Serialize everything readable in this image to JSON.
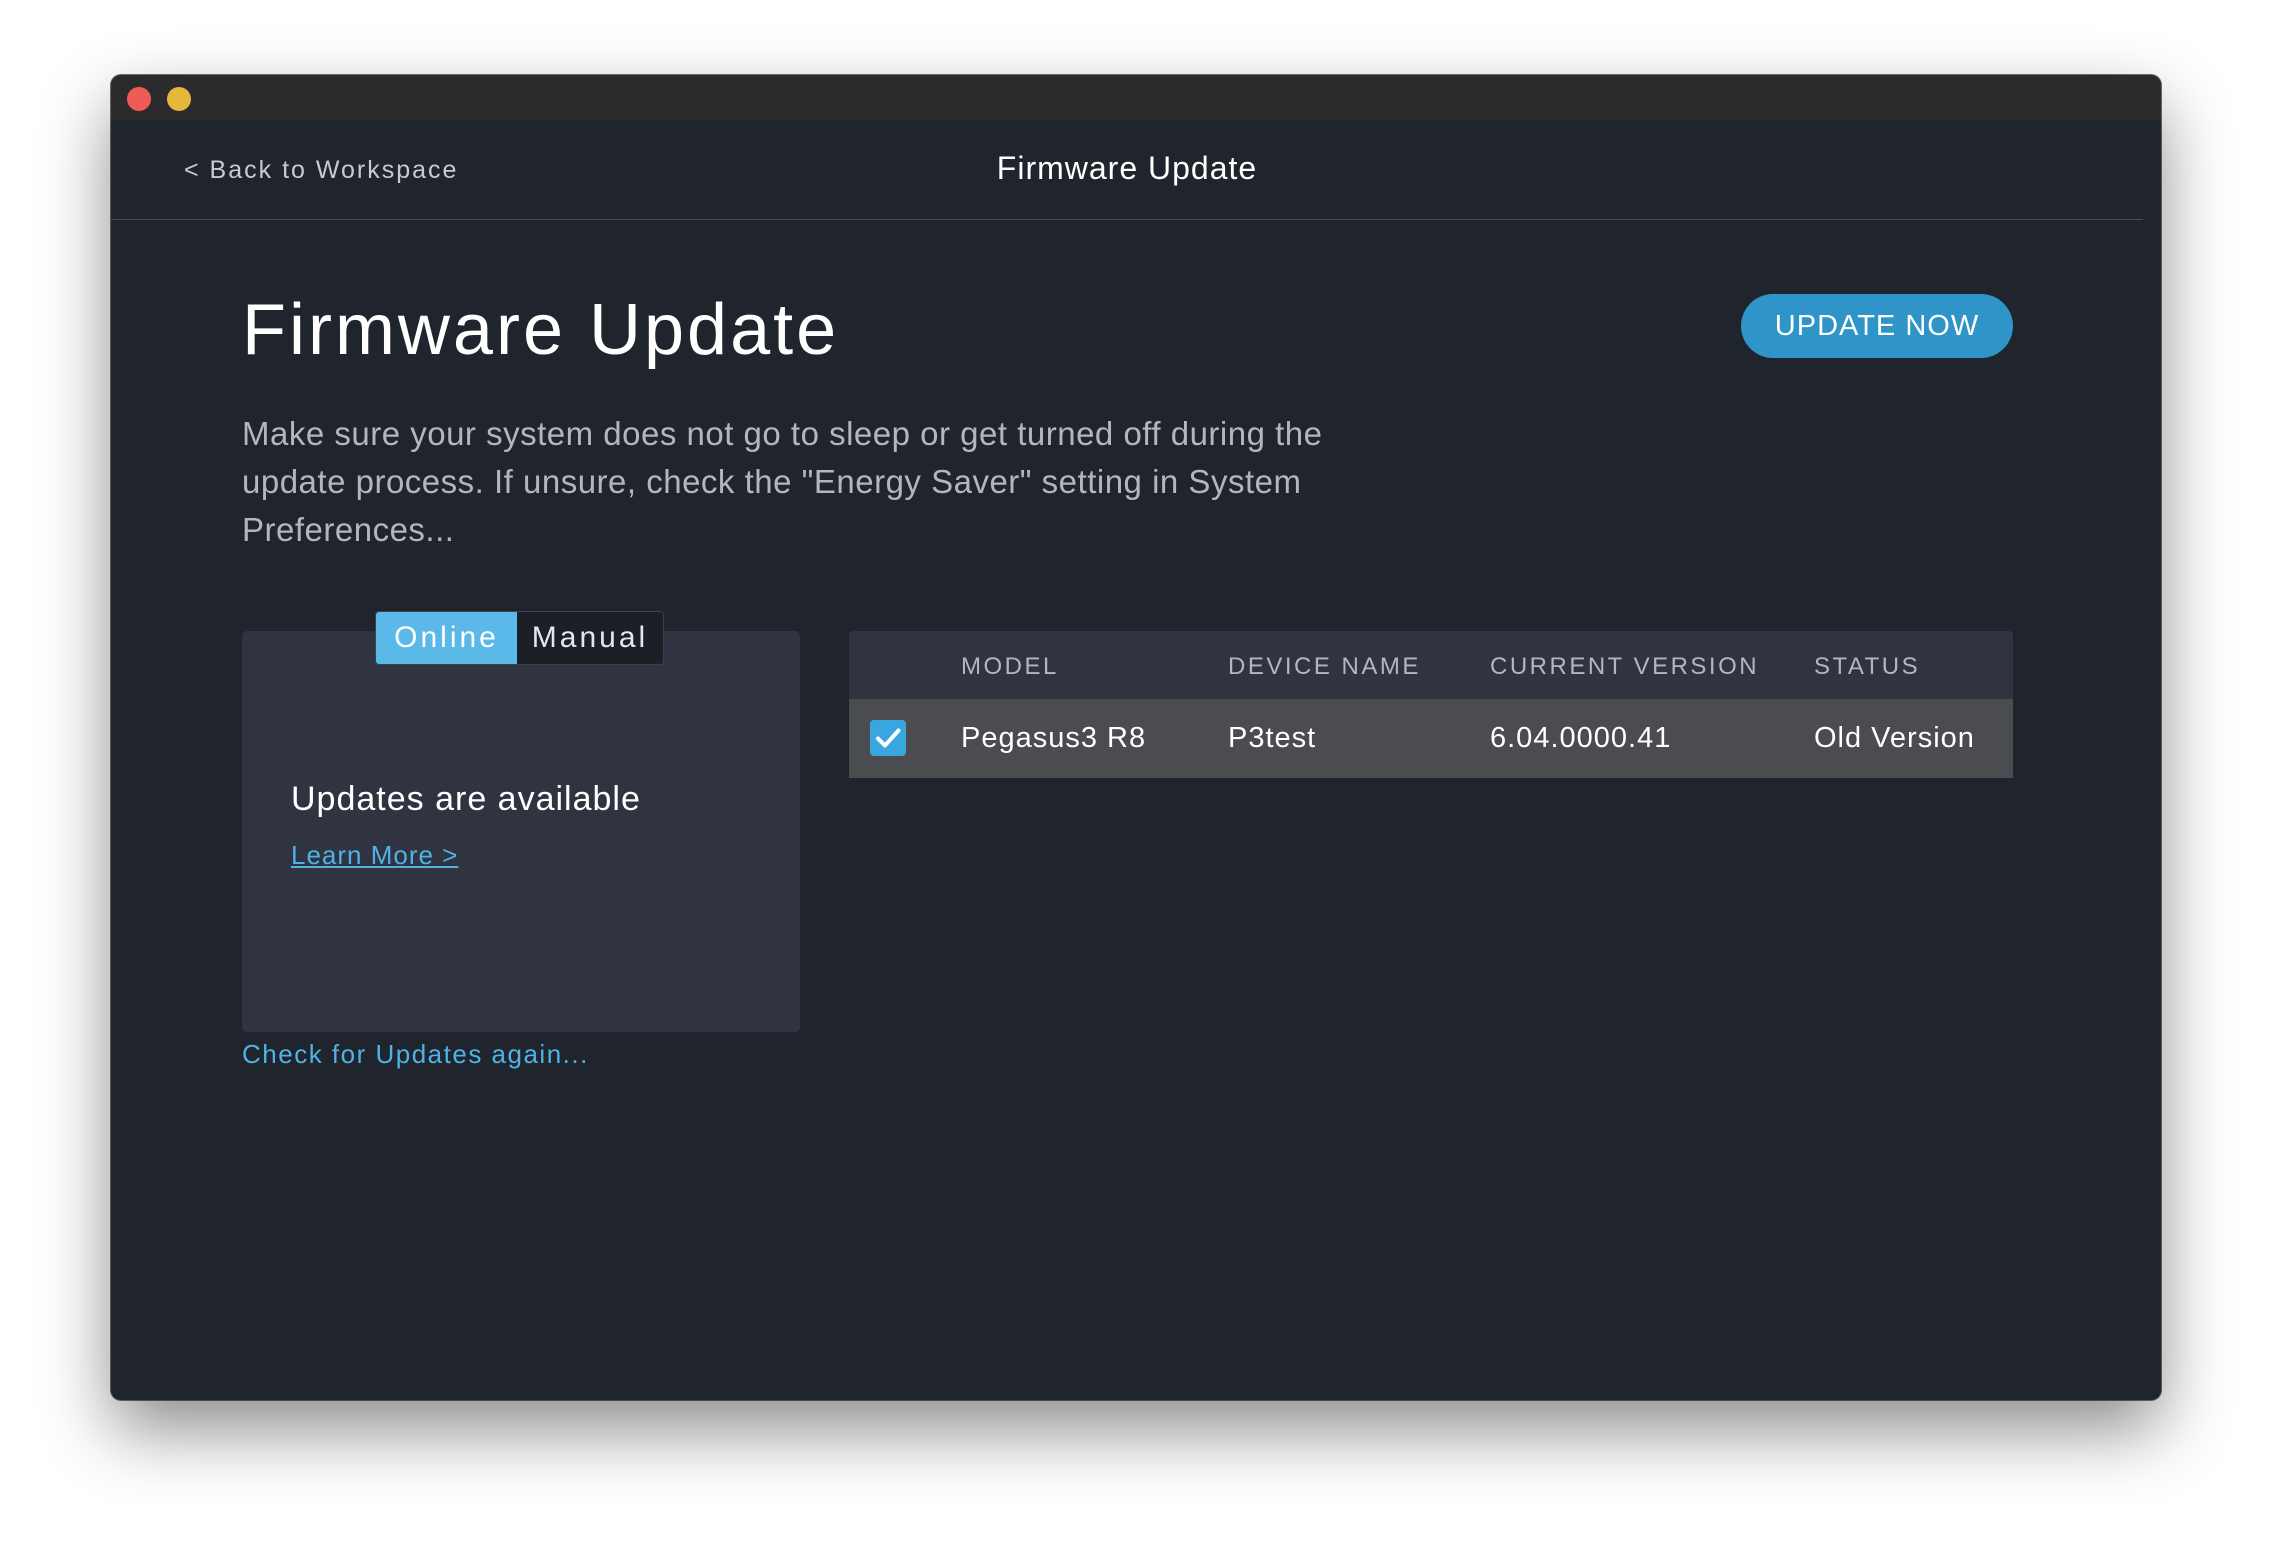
{
  "window": {
    "close_label": "",
    "minimize_label": ""
  },
  "nav": {
    "back_label": "< Back to Workspace",
    "title": "Firmware Update"
  },
  "main": {
    "title": "Firmware Update",
    "update_button": "UPDATE NOW",
    "description": "Make sure your system does not go to sleep or get turned off during the update process. If unsure, check the \"Energy Saver\" setting in System Preferences..."
  },
  "mode": {
    "options": [
      "Online",
      "Manual"
    ],
    "selected": "Online"
  },
  "status_panel": {
    "message": "Updates are available",
    "learn_more": "Learn More >",
    "check_again": "Check for Updates again..."
  },
  "devices": {
    "columns": [
      "MODEL",
      "DEVICE NAME",
      "CURRENT VERSION",
      "STATUS"
    ],
    "rows": [
      {
        "selected": true,
        "model": "Pegasus3 R8",
        "device_name": "P3test",
        "current_version": "6.04.0000.41",
        "status": "Old Version"
      }
    ]
  },
  "colors": {
    "accent": "#2f94c8",
    "link": "#4fb2e6",
    "segment_active": "#5ab9e8",
    "background": "#20242c",
    "panel": "#2f3440",
    "row_selected": "#4a4c50"
  }
}
